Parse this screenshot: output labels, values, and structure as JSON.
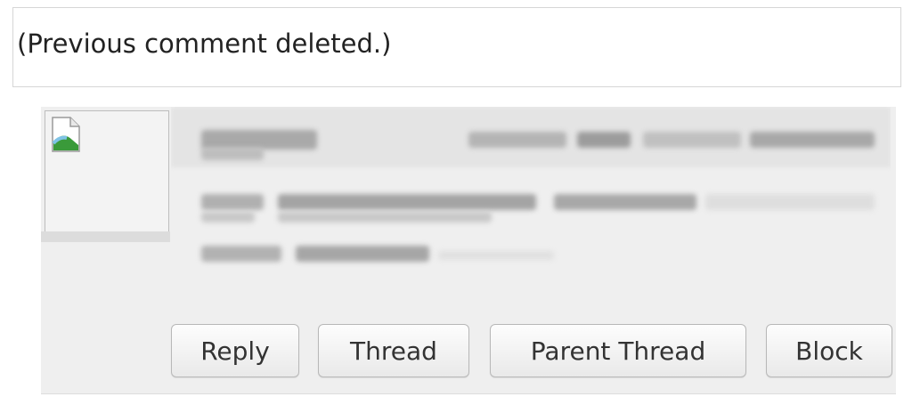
{
  "deleted_notice": {
    "text": "(Previous comment deleted.)"
  },
  "comment": {
    "avatar": {
      "icon": "broken-image-icon"
    },
    "actions": {
      "reply_label": "Reply",
      "thread_label": "Thread",
      "parent_thread_label": "Parent Thread",
      "block_label": "Block"
    }
  },
  "colors": {
    "page_background": "#ffffff",
    "comment_background": "#efefef",
    "border": "#d6d6d6",
    "text": "#222222"
  }
}
